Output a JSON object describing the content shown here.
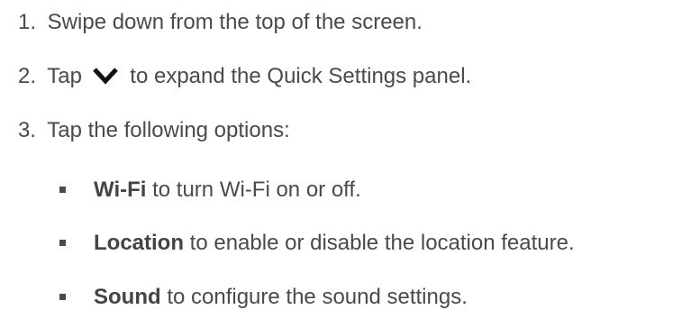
{
  "steps": [
    {
      "number": "1.",
      "text": "Swipe down from the top of the screen."
    },
    {
      "number": "2.",
      "pre": "Tap",
      "icon": "chevron-down-icon",
      "post": "to expand the Quick Settings panel."
    },
    {
      "number": "3.",
      "text": "Tap the following options:"
    }
  ],
  "options": [
    {
      "label": "Wi-Fi",
      "description": "to turn Wi-Fi on or off."
    },
    {
      "label": "Location",
      "description": "to enable or disable the location feature."
    },
    {
      "label": "Sound",
      "description": "to configure the sound settings."
    }
  ],
  "colors": {
    "text": "#4a4a4a"
  }
}
